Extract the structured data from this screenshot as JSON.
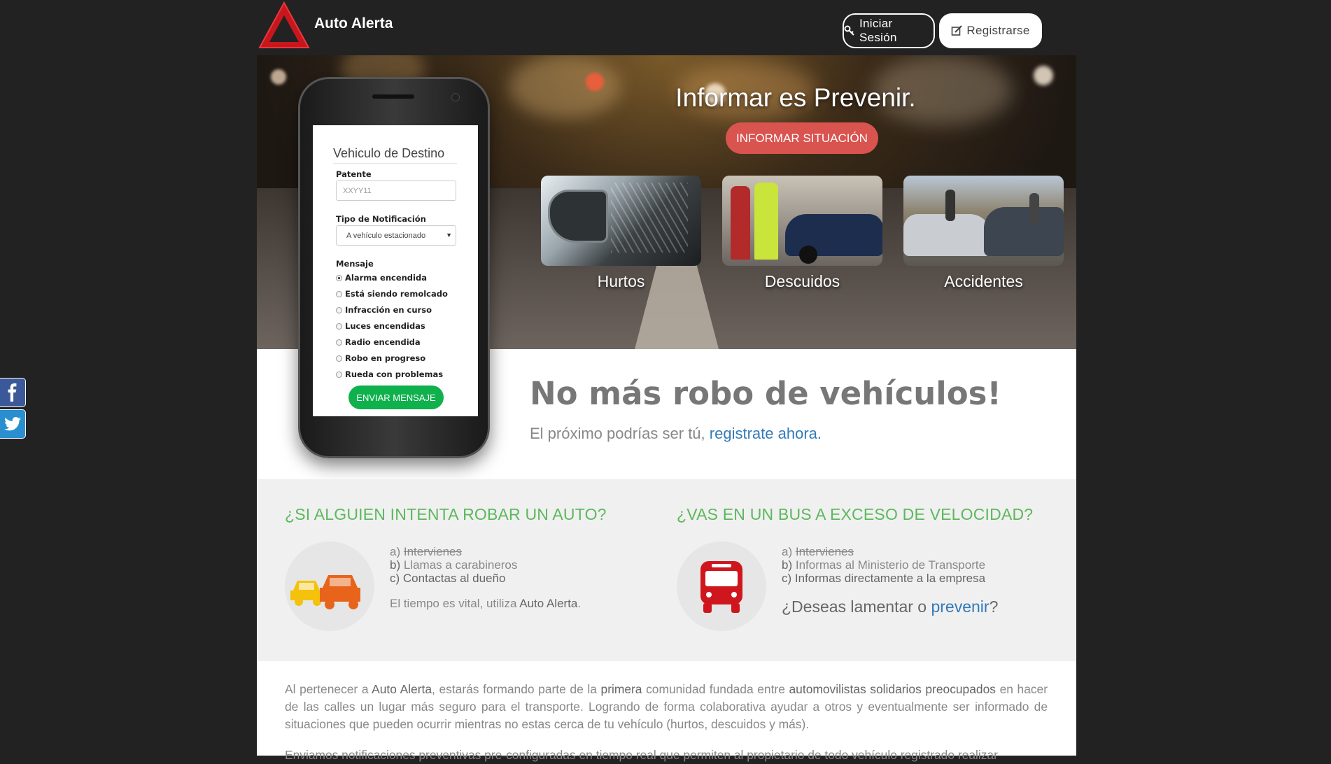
{
  "header": {
    "brand": "Auto Alerta",
    "login_label": "Iniciar Sesión",
    "register_label": "Registrarse"
  },
  "hero": {
    "title": "Informar es Prevenir.",
    "cta_label": "INFORMAR SITUACIÓN",
    "categories": [
      {
        "label": "Hurtos"
      },
      {
        "label": "Descuidos"
      },
      {
        "label": "Accidentes"
      }
    ]
  },
  "phone_form": {
    "title": "Vehiculo de Destino",
    "plate_label": "Patente",
    "plate_placeholder": "XXYY11",
    "notif_label": "Tipo de Notificación",
    "notif_value": "A vehículo estacionado",
    "message_label": "Mensaje",
    "options": [
      {
        "label": "Alarma encendida",
        "selected": true
      },
      {
        "label": "Está siendo remolcado",
        "selected": false
      },
      {
        "label": "Infracción en curso",
        "selected": false
      },
      {
        "label": "Luces encendidas",
        "selected": false
      },
      {
        "label": "Radio encendida",
        "selected": false
      },
      {
        "label": "Robo en progreso",
        "selected": false
      },
      {
        "label": "Rueda con problemas",
        "selected": false
      }
    ],
    "send_label": "ENVIAR MENSAJE"
  },
  "banner": {
    "headline": "No más robo de vehículos!",
    "sub_prefix": "El próximo podrías ser tú,",
    "sub_link": "registrate ahora."
  },
  "scenarios": {
    "car": {
      "heading": "¿SI ALGUIEN INTENTA ROBAR UN AUTO?",
      "a_prefix": "a)",
      "a_text": "Intervienes",
      "b_prefix": "b)",
      "b_text": "Llamas a carabineros",
      "c_prefix": "c)",
      "c_text": "Contactas al dueño",
      "note_prefix": "El tiempo es vital, utiliza",
      "note_brand": "Auto Alerta",
      "note_suffix": "."
    },
    "bus": {
      "heading": "¿VAS EN UN BUS A EXCESO DE VELOCIDAD?",
      "a_prefix": "a)",
      "a_text": "Intervienes",
      "b_prefix": "b)",
      "b_text": "Informas al Ministerio de Transporte",
      "c_prefix": "c)",
      "c_text": "Informas directamente a la empresa",
      "note_prefix": "¿Deseas lamentar o",
      "note_link": "prevenir",
      "note_suffix": "?"
    }
  },
  "about": {
    "p1_parts": [
      "Al pertenecer a ",
      "Auto Alerta",
      ", estarás formando parte de la ",
      "primera",
      " comunidad fundada entre ",
      "automovilistas solidarios preocupados",
      " en hacer de las calles un lugar más seguro para el transporte. Logrando de forma colaborativa ayudar a otros y eventualmente ser informado de situaciones que pueden ocurrir mientras no estas cerca de tu vehículo (hurtos, descuidos y más)."
    ],
    "p2": "Enviamos notificaciones preventivas pre-configuradas en tiempo real que permiten al propietario de todo vehículo registrado realizar"
  },
  "colors": {
    "background": "#222222",
    "accent_red": "#d9534f",
    "accent_green": "#5cb85c",
    "send_green": "#0fb14d",
    "link_blue": "#337ab7"
  },
  "icons": [
    "warning-triangle-logo",
    "key-icon",
    "edit-icon",
    "cars-icon",
    "bus-icon",
    "facebook-icon",
    "twitter-icon"
  ]
}
